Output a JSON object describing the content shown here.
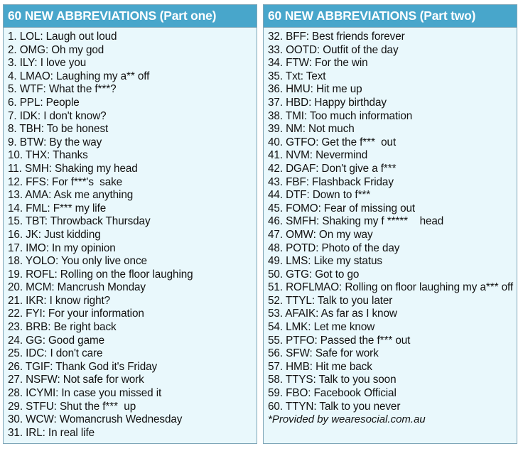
{
  "colors": {
    "header_bg": "#48a6cb",
    "header_text": "#ffffff",
    "body_bg": "#e9f8fc",
    "border": "#7fa6b8",
    "text": "#111111"
  },
  "part_one": {
    "title": "60 NEW ABBREVIATIONS (Part one)",
    "items": [
      "1. LOL: Laugh out loud",
      "2. OMG: Oh my god",
      "3. ILY: I love you",
      "4. LMAO: Laughing my a** off",
      "5. WTF: What the f***?",
      "6. PPL: People",
      "7. IDK: I don't know?",
      "8. TBH: To be honest",
      "9. BTW: By the way",
      "10. THX: Thanks",
      "11. SMH: Shaking my head",
      "12. FFS: For f***'s  sake",
      "13. AMA: Ask me anything",
      "14. FML: F*** my life",
      "15. TBT: Throwback Thursday",
      "16. JK: Just kidding",
      "17. IMO: In my opinion",
      "18. YOLO: You only live once",
      "19. ROFL: Rolling on the floor laughing",
      "20. MCM: Mancrush Monday",
      "21. IKR: I know right?",
      "22. FYI: For your information",
      "23. BRB: Be right back",
      "24. GG: Good game",
      "25. IDC: I don't care",
      "26. TGIF: Thank God it's Friday",
      "27. NSFW: Not safe for work",
      "28. ICYMI: In case you missed it",
      "29. STFU: Shut the f***  up",
      "30. WCW: Womancrush Wednesday",
      "31. IRL: In real life"
    ]
  },
  "part_two": {
    "title": "60 NEW ABBREVIATIONS (Part two)",
    "items": [
      "32. BFF: Best friends forever",
      "33. OOTD: Outfit of the day",
      "34. FTW: For the win",
      "35. Txt: Text",
      "36. HMU: Hit me up",
      "37. HBD: Happy birthday",
      "38. TMI: Too much information",
      "39. NM: Not much",
      "40. GTFO: Get the f***  out",
      "41. NVM: Nevermind",
      "42. DGAF: Don't give a f***",
      "43. FBF: Flashback Friday",
      "44. DTF: Down to f***",
      "45. FOMO: Fear of missing out",
      "46. SMFH: Shaking my f *****    head",
      "47. OMW: On my way",
      "48. POTD: Photo of the day",
      "49. LMS: Like my status",
      "50. GTG: Got to go",
      "51. ROFLMAO: Rolling on floor laughing my a*** off",
      "52. TTYL: Talk to you later",
      "53. AFAIK: As far as I know",
      "54. LMK: Let me know",
      "55. PTFO: Passed the f*** out",
      "56. SFW: Safe for work",
      "57. HMB: Hit me back",
      "58. TTYS: Talk to you soon",
      "59. FBO: Facebook Official",
      "60. TTYN: Talk to you never"
    ],
    "credit": "*Provided by wearesocial.com.au"
  }
}
